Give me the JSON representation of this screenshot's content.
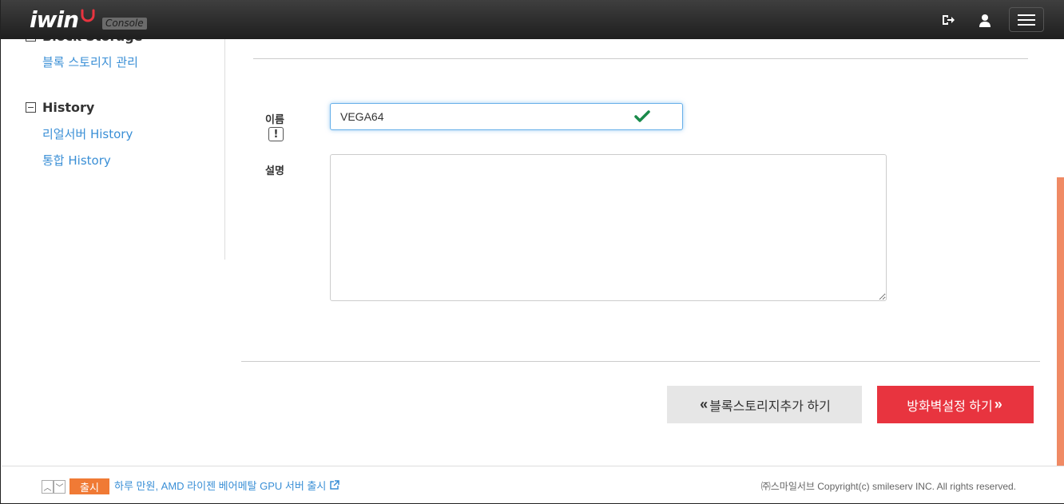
{
  "header": {
    "logo_text": "iwin",
    "console_badge": "Console",
    "icons": {
      "logout": "logout-icon",
      "user": "user-icon",
      "menu": "menu-icon"
    }
  },
  "sidebar": {
    "partial_item": "블록 스토리지 관리",
    "group_title": "History",
    "items": [
      {
        "label": "리얼서버 History"
      },
      {
        "label": "통합 History"
      }
    ]
  },
  "form": {
    "name_label": "이름",
    "name_value": "VEGA64",
    "desc_label": "설명",
    "desc_value": ""
  },
  "buttons": {
    "prev_label": "블록스토리지추가 하기",
    "next_label": "방화벽설정 하기"
  },
  "footer": {
    "badge": "출시",
    "news": "하루 만원, AMD 라이젠 베어메탈 GPU 서버 출시",
    "copyright": "㈜스마일서브 Copyright(c) smileserv INC. All rights reserved."
  },
  "colors": {
    "accent_red": "#e8343f",
    "link_blue": "#3a8fd6",
    "badge_orange": "#f07a35",
    "check_green": "#1a8a4a"
  }
}
